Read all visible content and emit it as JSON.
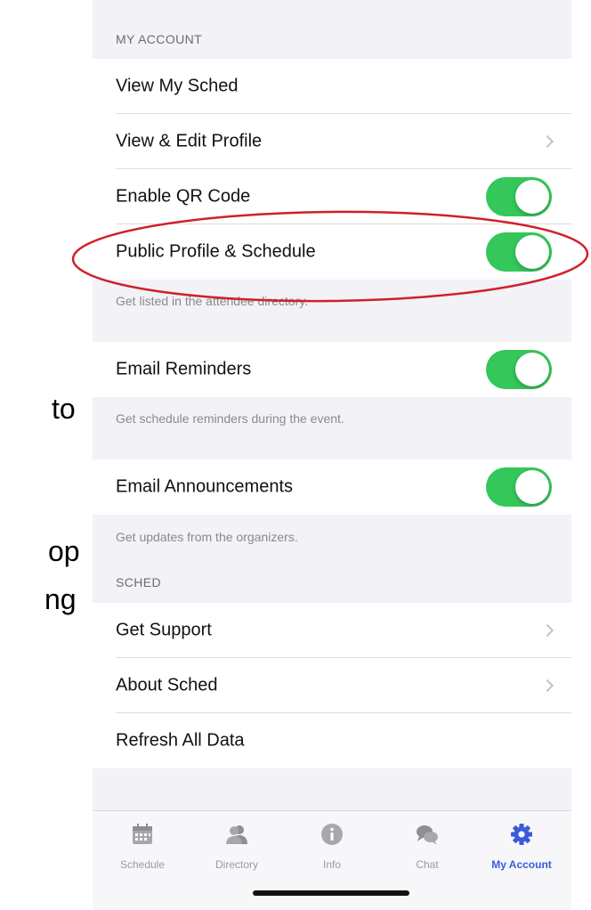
{
  "background_fragments": {
    "to": "to",
    "op": "op",
    "ng": "ng"
  },
  "sections": {
    "my_account": "MY ACCOUNT",
    "sched": "SCHED"
  },
  "rows": {
    "view_my_sched": "View My Sched",
    "view_edit_profile": "View & Edit Profile",
    "enable_qr": "Enable QR Code",
    "public_profile": "Public Profile & Schedule",
    "email_reminders": "Email Reminders",
    "email_announcements": "Email Announcements",
    "get_support": "Get Support",
    "about_sched": "About Sched",
    "refresh_all": "Refresh All Data"
  },
  "toggles": {
    "enable_qr": true,
    "public_profile": true,
    "email_reminders": true,
    "email_announcements": true
  },
  "notes": {
    "public_profile": "Get listed in the attendee directory.",
    "email_reminders": "Get schedule reminders during the event.",
    "email_announcements": "Get updates from the organizers."
  },
  "tabs": [
    {
      "label": "Schedule",
      "icon": "calendar-icon",
      "active": false
    },
    {
      "label": "Directory",
      "icon": "people-icon",
      "active": false
    },
    {
      "label": "Info",
      "icon": "info-icon",
      "active": false
    },
    {
      "label": "Chat",
      "icon": "chat-icon",
      "active": false
    },
    {
      "label": "My Account",
      "icon": "gear-icon",
      "active": true
    }
  ],
  "colors": {
    "toggle_on": "#34c759",
    "accent": "#3a5bd9",
    "highlight_ellipse": "#d0202a"
  }
}
